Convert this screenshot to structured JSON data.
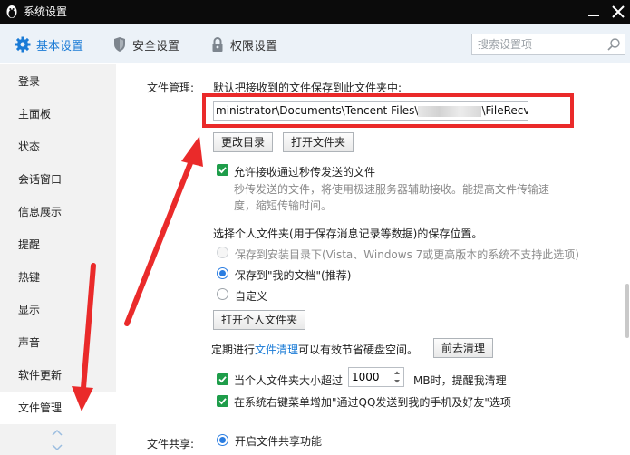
{
  "window": {
    "title": "系统设置"
  },
  "tabs": [
    {
      "label": "基本设置",
      "icon": "gear-icon"
    },
    {
      "label": "安全设置",
      "icon": "shield-icon"
    },
    {
      "label": "权限设置",
      "icon": "lock-icon"
    }
  ],
  "search": {
    "placeholder": "搜索设置项",
    "value": ""
  },
  "sidebar": {
    "items": [
      {
        "label": "登录"
      },
      {
        "label": "主面板"
      },
      {
        "label": "状态"
      },
      {
        "label": "会话窗口"
      },
      {
        "label": "信息展示"
      },
      {
        "label": "提醒"
      },
      {
        "label": "热键"
      },
      {
        "label": "显示"
      },
      {
        "label": "声音"
      },
      {
        "label": "软件更新"
      },
      {
        "label": "文件管理"
      }
    ],
    "active": "文件管理"
  },
  "file_management": {
    "section_label": "文件管理:",
    "save_prompt": "默认把接收到的文件保存到此文件夹中:",
    "path_start": "ministrator\\Documents\\Tencent Files\\",
    "path_end": "\\FileRecv\\",
    "change_dir_button": "更改目录",
    "open_folder_button": "打开文件夹",
    "allow_flash_transfer": {
      "label": "允许接收通过秒传发送的文件",
      "checked": true
    },
    "flash_hint_1": "秒传发送的文件，将使用极速服务器辅助接收。能提高文件传输速",
    "flash_hint_2": "度，缩短传输时间。",
    "personal_folder_prompt": "选择个人文件夹(用于保存消息记录等数据)的保存位置。",
    "radio_install_dir": {
      "label": "保存到安装目录下(Vista、Windows 7或更高版本的系统不支持此选项)",
      "selected": false,
      "enabled": false
    },
    "radio_my_docs": {
      "label": "保存到\"我的文档\"(推荐)",
      "selected": true
    },
    "radio_custom": {
      "label": "自定义",
      "selected": false
    },
    "open_personal_folder_button": "打开个人文件夹",
    "cleanup_prefix": "定期进行",
    "cleanup_link": "文件清理",
    "cleanup_suffix": "可以有效节省硬盘空间。",
    "go_cleanup_button": "前去清理",
    "size_alert": {
      "label_before": "当个人文件夹大小超过",
      "value": "1000",
      "label_after": "MB时，提醒我清理",
      "checked": true
    },
    "context_menu": {
      "label": "在系统右键菜单增加\"通过QQ发送到我的手机及好友\"选项",
      "checked": true
    }
  },
  "file_sharing": {
    "section_label": "文件共享:",
    "enable": {
      "label": "开启文件共享功能",
      "selected": true
    }
  },
  "colors": {
    "accent": "#1a7bd6",
    "annotation_red": "#ea2a2a",
    "check_green": "#1e9d4a"
  }
}
